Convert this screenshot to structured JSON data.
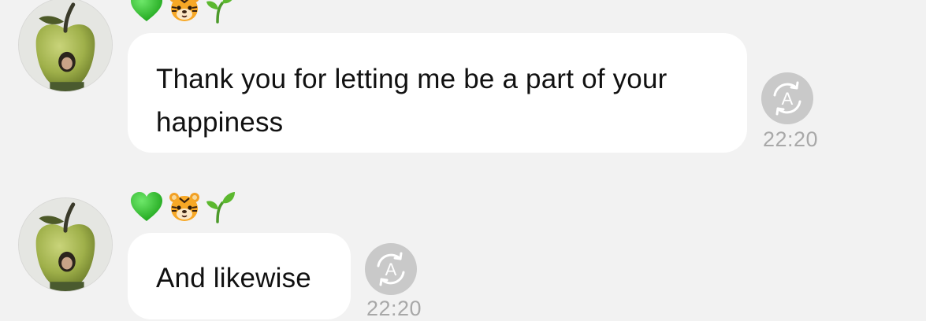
{
  "messages": [
    {
      "text": "Thank you for letting me be a part of your\nhappiness",
      "time": "22:20",
      "reactions": [
        "green-heart",
        "tiger-face",
        "seedling"
      ]
    },
    {
      "text": "And likewise",
      "time": "22:20",
      "reactions": [
        "green-heart",
        "tiger-face",
        "seedling"
      ]
    }
  ],
  "translate_icon_letter": "A",
  "colors": {
    "background": "#f2f2f2",
    "bubble": "#ffffff",
    "text": "#111111",
    "timestamp": "#a8a8a8",
    "translate_icon": "#c4c4c4"
  }
}
